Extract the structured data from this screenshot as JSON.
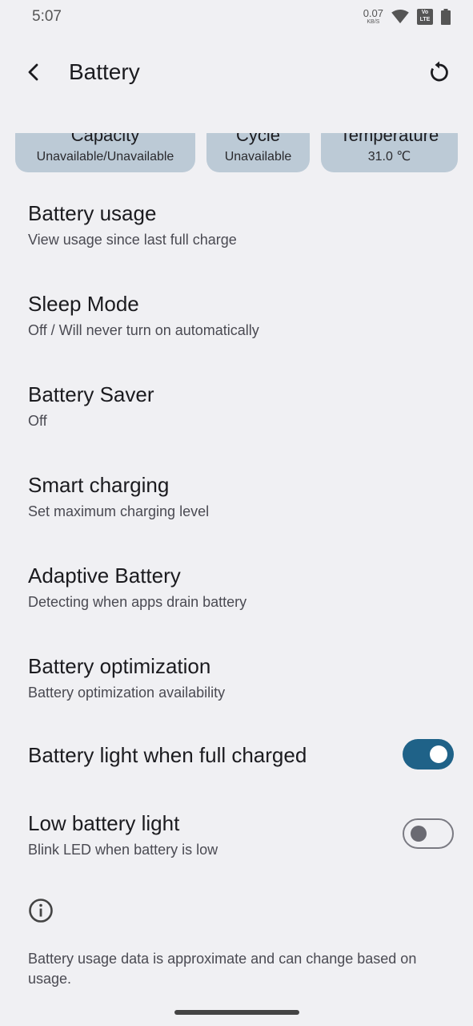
{
  "status_bar": {
    "time": "5:07",
    "net_speed_value": "0.07",
    "net_speed_unit": "KB/S",
    "volte_label": "Vo LTE"
  },
  "app_bar": {
    "title": "Battery"
  },
  "chips": [
    {
      "label": "Capacity",
      "value": "Unavailable/Unavailable"
    },
    {
      "label": "Cycle",
      "value": "Unavailable"
    },
    {
      "label": "Temperature",
      "value": "31.0 ℃"
    }
  ],
  "settings": [
    {
      "title": "Battery usage",
      "subtitle": "View usage since last full charge"
    },
    {
      "title": "Sleep Mode",
      "subtitle": "Off / Will never turn on automatically"
    },
    {
      "title": "Battery Saver",
      "subtitle": "Off"
    },
    {
      "title": "Smart charging",
      "subtitle": "Set maximum charging level"
    },
    {
      "title": "Adaptive Battery",
      "subtitle": "Detecting when apps drain battery"
    },
    {
      "title": "Battery optimization",
      "subtitle": "Battery optimization availability"
    }
  ],
  "toggles": [
    {
      "title": "Battery light when full charged",
      "subtitle": "",
      "state": "on"
    },
    {
      "title": "Low battery light",
      "subtitle": "Blink LED when battery is low",
      "state": "off"
    }
  ],
  "footer": {
    "text": "Battery usage data is approximate and can change based on usage."
  },
  "colors": {
    "background": "#f0f0f3",
    "chip": "#bccad6",
    "switch_on": "#1f6288"
  },
  "icons": [
    "back-arrow-icon",
    "reset-icon",
    "wifi-icon",
    "battery-icon",
    "info-icon"
  ]
}
